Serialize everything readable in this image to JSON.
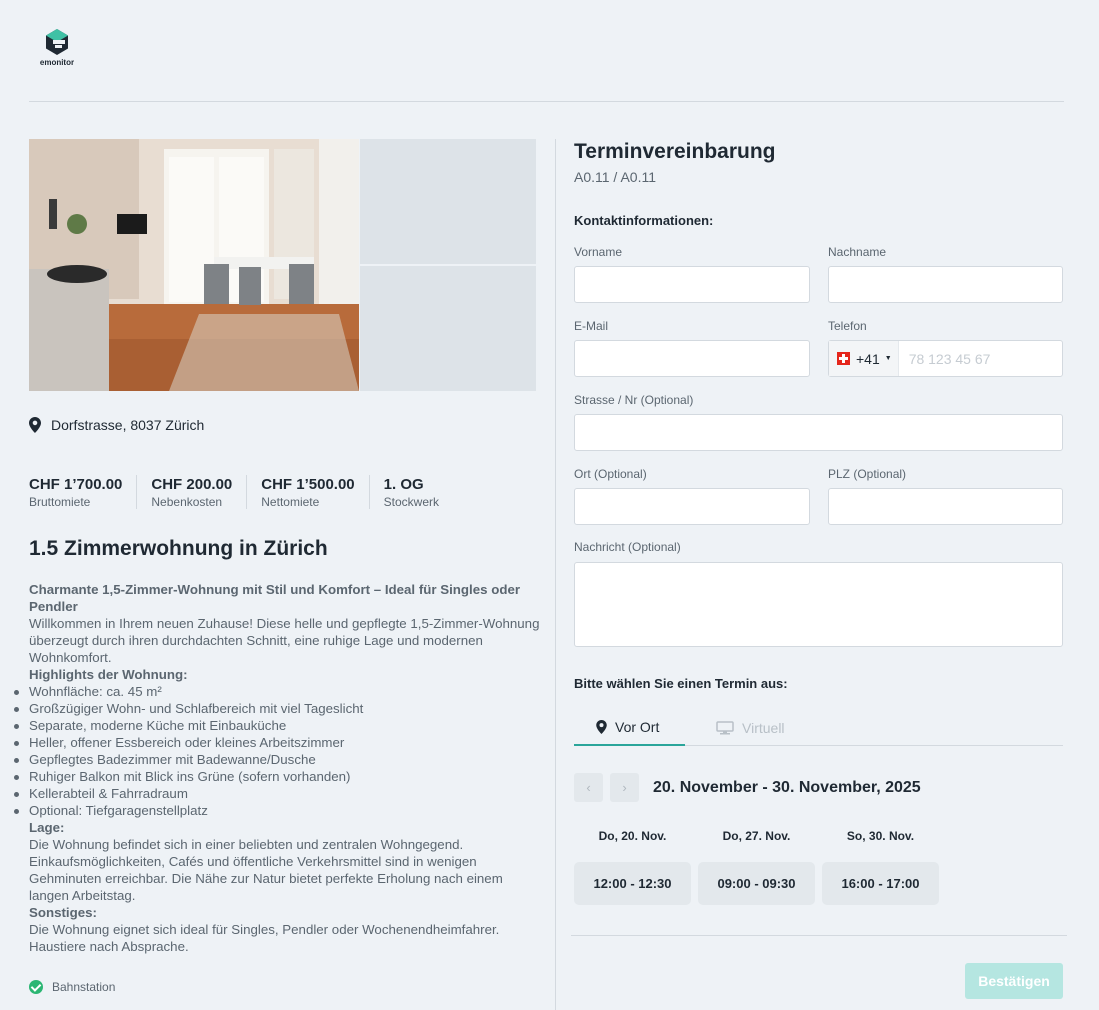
{
  "brand": {
    "name": "emonitor"
  },
  "listing": {
    "address": "Dorfstrasse, 8037 Zürich",
    "stats": [
      {
        "value": "CHF 1’700.00",
        "label": "Bruttomiete"
      },
      {
        "value": "CHF 200.00",
        "label": "Nebenkosten"
      },
      {
        "value": "CHF 1’500.00",
        "label": "Nettomiete"
      },
      {
        "value": "1. OG",
        "label": "Stockwerk"
      }
    ],
    "title": "1.5 Zimmerwohnung in Zürich",
    "description": {
      "headline": "Charmante 1,5-Zimmer-Wohnung mit Stil und Komfort – Ideal für Singles oder Pendler",
      "intro": "Willkommen in Ihrem neuen Zuhause! Diese helle und gepflegte 1,5-Zimmer-Wohnung überzeugt durch ihren durchdachten Schnitt, eine ruhige Lage und modernen Wohnkomfort.",
      "highlights_heading": "Highlights der Wohnung:",
      "highlights": [
        "Wohnfläche: ca. 45 m²",
        "Großzügiger Wohn- und Schlafbereich mit viel Tageslicht",
        "Separate, moderne Küche mit Einbauküche",
        "Heller, offener Essbereich oder kleines Arbeitszimmer",
        "Gepflegtes Badezimmer mit Badewanne/Dusche",
        "Ruhiger Balkon mit Blick ins Grüne (sofern vorhanden)",
        "Kellerabteil & Fahrradraum",
        "Optional: Tiefgaragenstellplatz"
      ],
      "location_heading": "Lage:",
      "location_text": "Die Wohnung befindet sich in einer beliebten und zentralen Wohngegend. Einkaufsmöglichkeiten, Cafés und öffentliche Verkehrsmittel sind in wenigen Gehminuten erreichbar. Die Nähe zur Natur bietet perfekte Erholung nach einem langen Arbeitstag.",
      "misc_heading": "Sonstiges:",
      "misc_text": "Die Wohnung eignet sich ideal für Singles, Pendler oder Wochenendheimfahrer. Haustiere nach Absprache."
    },
    "feature": "Bahnstation"
  },
  "form": {
    "title": "Terminvereinbarung",
    "subtitle": "A0.11 / A0.11",
    "contact_heading": "Kontaktinformationen:",
    "fields": {
      "firstname": {
        "label": "Vorname",
        "value": ""
      },
      "lastname": {
        "label": "Nachname",
        "value": ""
      },
      "email": {
        "label": "E-Mail",
        "value": ""
      },
      "phone": {
        "label": "Telefon",
        "prefix": "+41",
        "placeholder": "78 123 45 67",
        "value": ""
      },
      "street": {
        "label": "Strasse / Nr (Optional)",
        "value": ""
      },
      "city": {
        "label": "Ort (Optional)",
        "value": ""
      },
      "zip": {
        "label": "PLZ (Optional)",
        "value": ""
      },
      "message": {
        "label": "Nachricht (Optional)",
        "value": ""
      }
    },
    "appointment_heading": "Bitte wählen Sie einen Termin aus:",
    "tabs": [
      {
        "label": "Vor Ort",
        "active": true,
        "icon": "map-pin-icon"
      },
      {
        "label": "Virtuell",
        "active": false,
        "icon": "monitor-icon"
      }
    ],
    "date_range": "20. November - 30. November, 2025",
    "slots": [
      {
        "day": "Do, 20. Nov.",
        "time": "12:00 - 12:30"
      },
      {
        "day": "Do, 27. Nov.",
        "time": "09:00 - 09:30"
      },
      {
        "day": "So, 30. Nov.",
        "time": "16:00 - 17:00"
      }
    ],
    "confirm_label": "Bestätigen"
  },
  "colors": {
    "background": "#eef2f6",
    "accent": "#2aa59a",
    "confirm_disabled": "#b5e6e1",
    "feature_check": "#2bb673"
  }
}
